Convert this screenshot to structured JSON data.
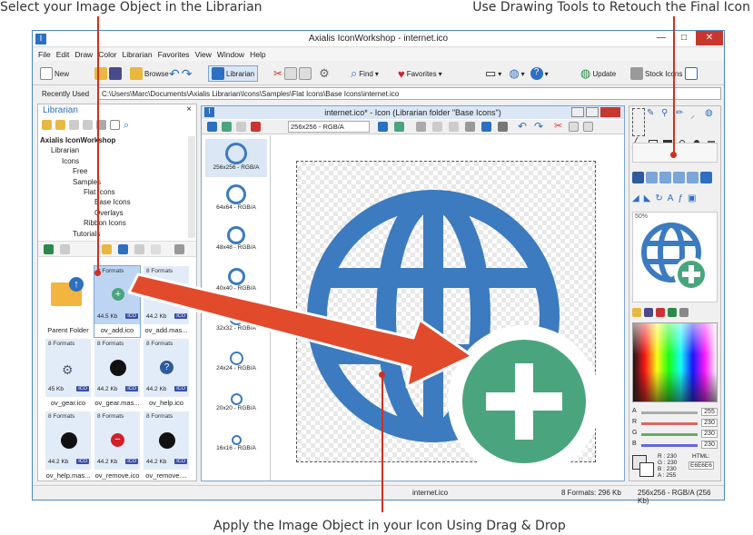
{
  "captions": {
    "top_left": "Select your Image Object in the Librarian",
    "top_right": "Use Drawing Tools to Retouch the Final Icon",
    "bottom": "Apply the Image Object in your Icon Using Drag & Drop"
  },
  "window": {
    "title": "Axialis IconWorkshop - internet.ico",
    "minimize": "—",
    "maximize": "□",
    "close": "✕"
  },
  "menu": [
    "File",
    "Edit",
    "Draw",
    "Color",
    "Librarian",
    "Favorites",
    "View",
    "Window",
    "Help"
  ],
  "toolbar": {
    "new": "New",
    "browse": "Browse",
    "librarian": "Librarian",
    "find": "Find",
    "favorites": "Favorites",
    "update": "Update",
    "stock_icons": "Stock Icons"
  },
  "address": {
    "label": "Recently Used",
    "path": "C:\\Users\\Marc\\Documents\\Axialis Librarian\\Icons\\Samples\\Flat Icons\\Base Icons\\internet.ico"
  },
  "librarian": {
    "title": "Librarian",
    "close": "×",
    "tree": [
      "Axialis IconWorkshop",
      "Librarian",
      "Icons",
      "Free",
      "Samples",
      "Flat Icons",
      "Base Icons",
      "Overlays",
      "Ribbon Icons",
      "Tutorials"
    ],
    "items": [
      {
        "name": "Parent Folder",
        "formats": "",
        "size": ""
      },
      {
        "name": "ov_add.ico",
        "formats": "8 Formats",
        "size": "44.5 Kb"
      },
      {
        "name": "ov_add.mas...",
        "formats": "8 Formats",
        "size": "44.2 Kb"
      },
      {
        "name": "ov_gear.ico",
        "formats": "8 Formats",
        "size": "45 Kb"
      },
      {
        "name": "ov_gear.mas...",
        "formats": "8 Formats",
        "size": "44.2 Kb"
      },
      {
        "name": "ov_help.ico",
        "formats": "8 Formats",
        "size": "44.2 Kb"
      },
      {
        "name": "ov_help.mas...",
        "formats": "8 Formats",
        "size": "44.2 Kb"
      },
      {
        "name": "ov_remove.ico",
        "formats": "8 Formats",
        "size": "44.2 Kb"
      },
      {
        "name": "ov_remove....",
        "formats": "8 Formats",
        "size": "44.2 Kb"
      }
    ],
    "badge": "ICO"
  },
  "document": {
    "title": "internet.ico* - Icon (Librarian folder \"Base Icons\")",
    "format_select": "256x256 - RGB/A",
    "formats": [
      "256x256 - RGB/A",
      "64x64 - RGB/A",
      "48x48 - RGB/A",
      "40x40 - RGB/A",
      "32x32 - RGB/A",
      "24x24 - RGB/A",
      "20x20 - RGB/A",
      "16x16 - RGB/A"
    ]
  },
  "right_panel": {
    "preview_zoom": "50%",
    "channels": [
      {
        "label": "A",
        "value": "255"
      },
      {
        "label": "R",
        "value": "230"
      },
      {
        "label": "G",
        "value": "230"
      },
      {
        "label": "B",
        "value": "230"
      }
    ],
    "readout": {
      "rgb": "R : 230\nG : 230\nB : 230\nA : 255",
      "html_label": "HTML:",
      "html_value": "E6E6E6"
    }
  },
  "status": {
    "file": "internet.ico",
    "formats": "8 Formats: 296 Kb",
    "image": "256x256 - RGB/A (256 Kb)"
  },
  "colors": {
    "accent_blue": "#3c7bbf",
    "green": "#4aa57e",
    "arrow_red": "#e24a2c"
  }
}
